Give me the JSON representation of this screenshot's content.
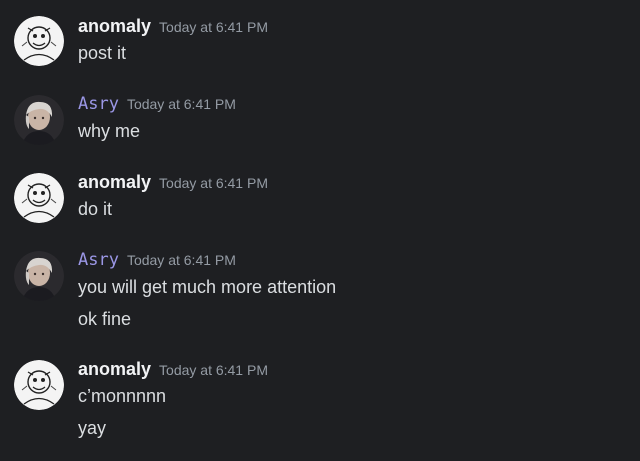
{
  "groups": [
    {
      "username": "anomaly",
      "timestamp": "Today at 6:41 PM",
      "lines": [
        "post it"
      ]
    },
    {
      "username": "Asry",
      "timestamp": "Today at 6:41 PM",
      "lines": [
        "why me"
      ]
    },
    {
      "username": "anomaly",
      "timestamp": "Today at 6:41 PM",
      "lines": [
        "do it"
      ]
    },
    {
      "username": "Asry",
      "timestamp": "Today at 6:41 PM",
      "lines": [
        "you will get much more attention",
        "ok fine"
      ]
    },
    {
      "username": "anomaly",
      "timestamp": "Today at 6:41 PM",
      "lines": [
        "c’monnnnn",
        "yay"
      ]
    }
  ],
  "colors": {
    "background": "#1e1f22",
    "username_default": "#f2f3f5",
    "username_asry": "#9b97e6",
    "timestamp": "#949ba4",
    "message_text": "#dbdee1"
  },
  "avatars": {
    "anomaly": "cartoon-sketch-avatar",
    "Asry": "photo-portrait-avatar"
  }
}
